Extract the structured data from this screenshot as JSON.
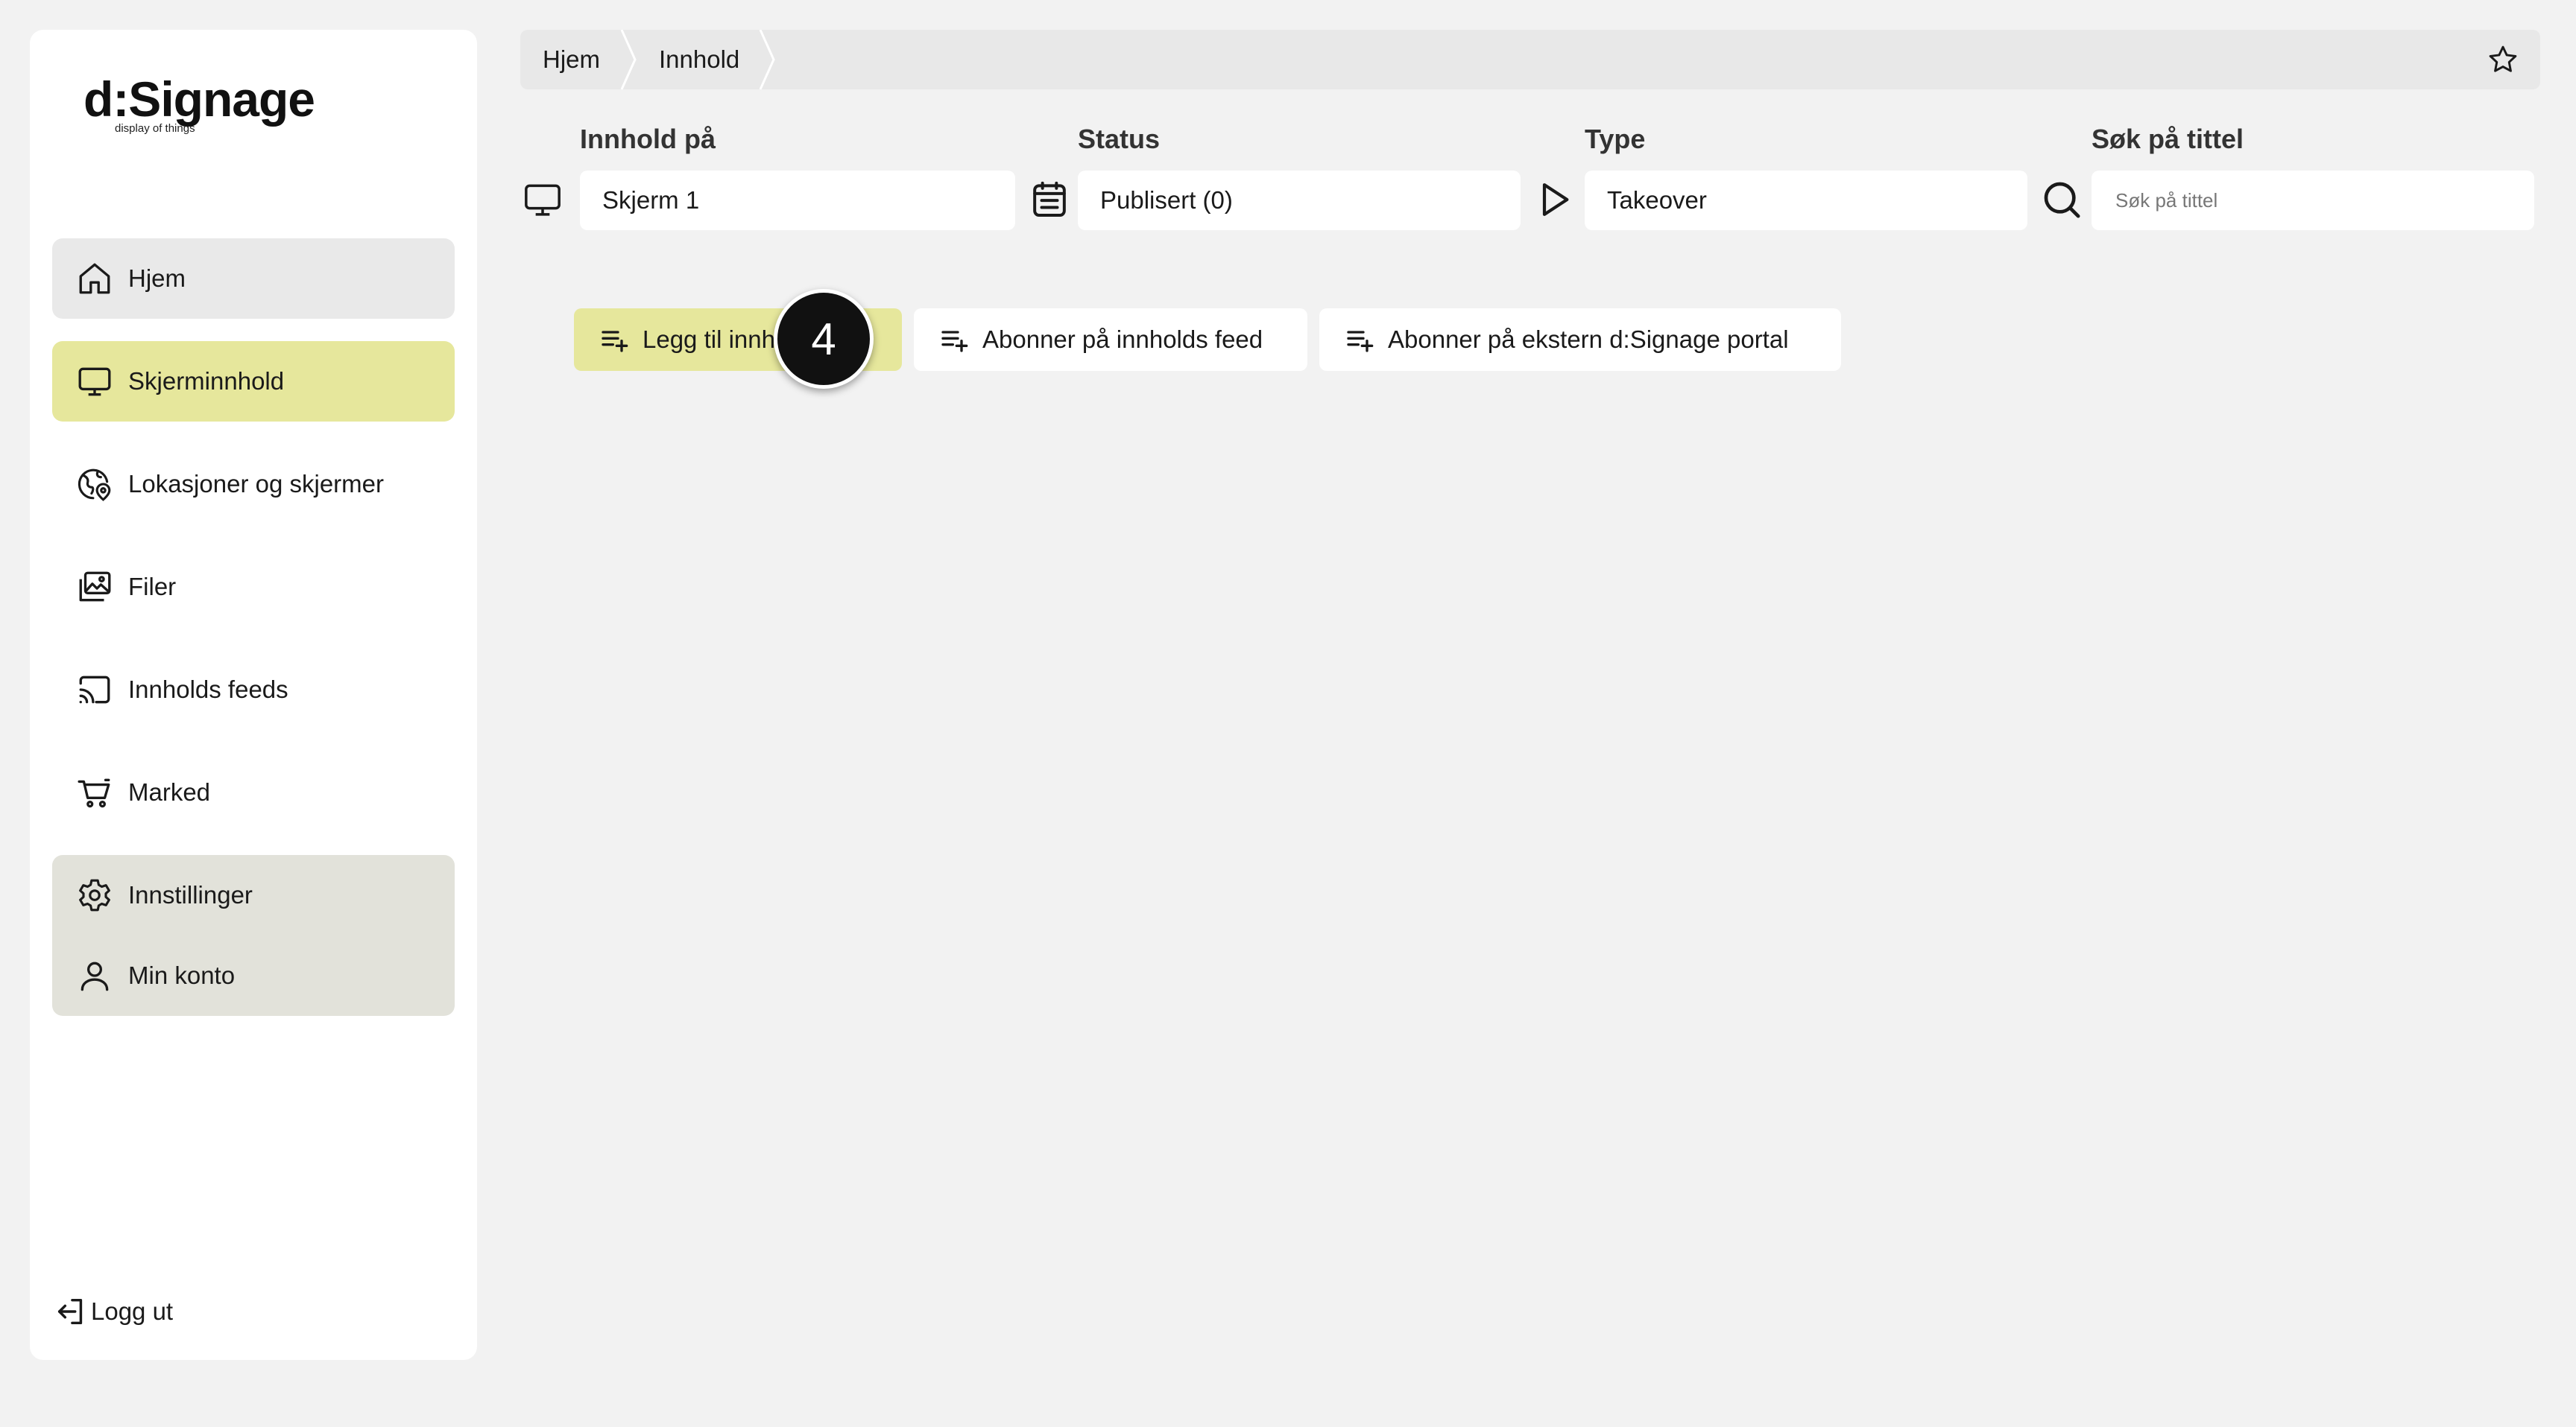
{
  "logo": {
    "name": "d:Signage",
    "tagline": "display of things"
  },
  "sidebar": {
    "items": [
      {
        "label": "Hjem",
        "icon": "home-icon"
      },
      {
        "label": "Skjerminnhold",
        "icon": "monitor-icon"
      },
      {
        "label": "Lokasjoner og skjermer",
        "icon": "globe-location-icon"
      },
      {
        "label": "Filer",
        "icon": "images-icon"
      },
      {
        "label": "Innholds feeds",
        "icon": "cast-icon"
      },
      {
        "label": "Marked",
        "icon": "cart-icon"
      }
    ],
    "bottom_items": [
      {
        "label": "Innstillinger",
        "icon": "gear-icon"
      },
      {
        "label": "Min konto",
        "icon": "user-icon"
      }
    ],
    "logout_label": "Logg ut"
  },
  "breadcrumb": {
    "items": [
      "Hjem",
      "Innhold"
    ]
  },
  "filters": {
    "screen": {
      "label": "Innhold på",
      "value": "Skjerm 1"
    },
    "status": {
      "label": "Status",
      "value": "Publisert (0)"
    },
    "type": {
      "label": "Type",
      "value": "Takeover"
    },
    "search": {
      "label": "Søk på tittel",
      "placeholder": "Søk på tittel"
    }
  },
  "actions": {
    "add_content": "Legg til innhold",
    "subscribe_feed": "Abonner på innholds feed",
    "subscribe_portal": "Abonner på ekstern d:Signage portal"
  },
  "step_badge": "4",
  "colors": {
    "accent": "#e6e79c",
    "background": "#f2f2f2",
    "panel": "#ffffff",
    "group": "#e2e2da"
  }
}
